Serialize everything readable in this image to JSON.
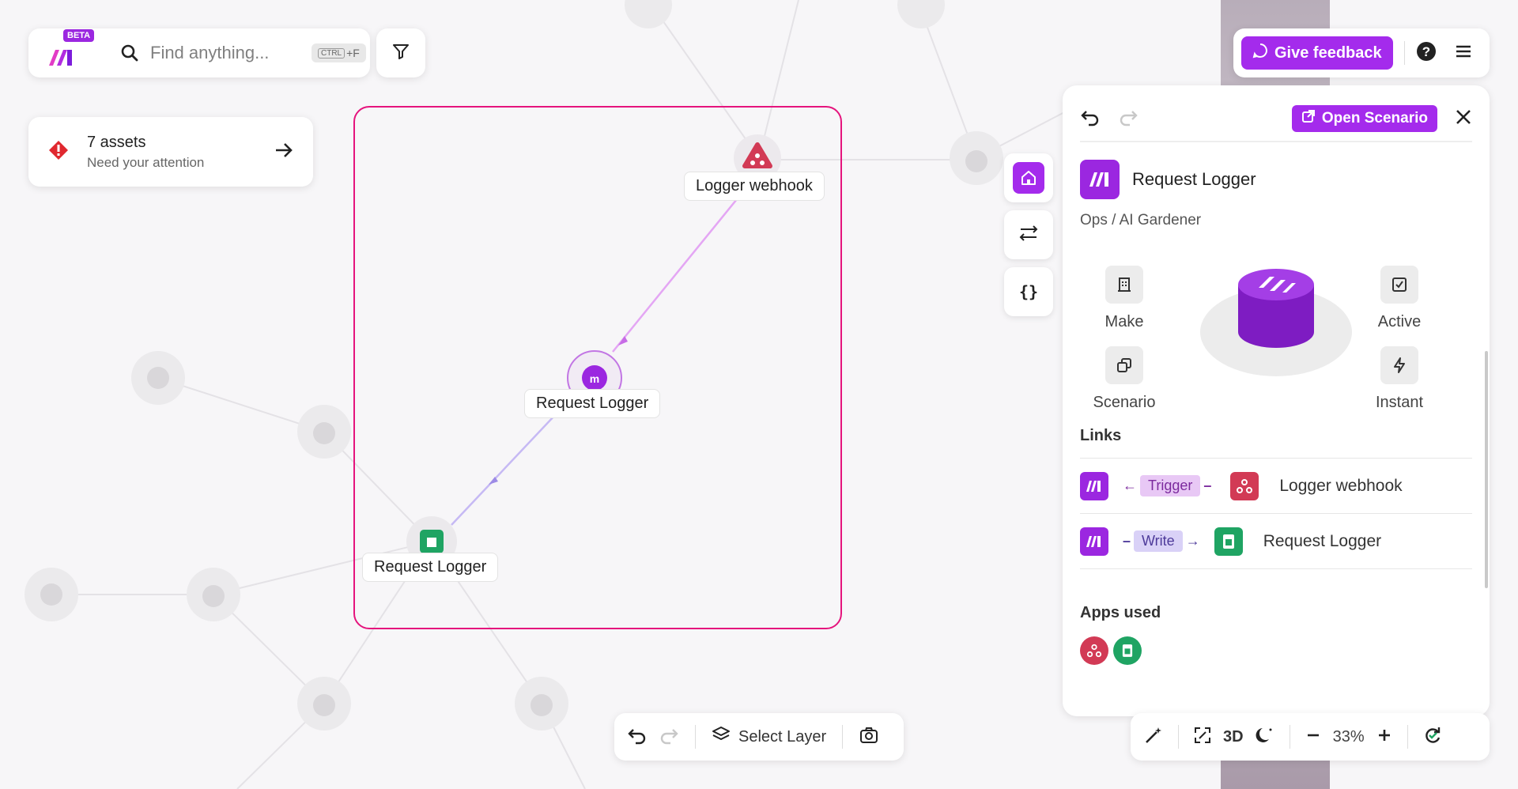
{
  "app": {
    "beta_badge": "BETA"
  },
  "search": {
    "placeholder": "Find anything...",
    "shortcut_key": "CTRL",
    "shortcut_suffix": "+F"
  },
  "attention": {
    "title": "7 assets",
    "subtitle": "Need your attention"
  },
  "canvas_nodes": {
    "webhook_label": "Logger webhook",
    "scenario_label": "Request Logger",
    "sheet_label": "Request Logger"
  },
  "topright": {
    "feedback_label": "Give feedback"
  },
  "panel": {
    "open_scenario_label": "Open Scenario",
    "asset_name": "Request Logger",
    "breadcrumb": "Ops / AI Gardener",
    "props": {
      "make": "Make",
      "scenario": "Scenario",
      "active": "Active",
      "instant": "Instant"
    },
    "links_title": "Links",
    "links": [
      {
        "pill": "Trigger",
        "name": "Logger webhook"
      },
      {
        "pill": "Write",
        "name": "Request Logger"
      }
    ],
    "apps_used_title": "Apps used"
  },
  "bottom": {
    "select_layer_label": "Select Layer"
  },
  "bottom_right": {
    "three_d_label": "3D",
    "zoom_level": "33%"
  },
  "colors": {
    "brand": "#a42bec",
    "selection": "#e5147d",
    "webhook": "#d23a55",
    "sheets": "#1fa463"
  },
  "icons": [
    "make-logo-icon",
    "search-icon",
    "filter-icon",
    "alert-icon",
    "arrow-right-icon",
    "home-icon",
    "sliders-icon",
    "braces-icon",
    "feedback-icon",
    "help-icon",
    "menu-icon",
    "undo-icon",
    "redo-icon",
    "open-external-icon",
    "close-icon",
    "building-icon",
    "copy-icon",
    "checkbox-icon",
    "bolt-icon",
    "webhook-icon",
    "sheets-icon",
    "layers-icon",
    "camera-icon",
    "magic-wand-icon",
    "expand-icon",
    "moon-icon",
    "minus-icon",
    "plus-icon",
    "sync-icon"
  ]
}
